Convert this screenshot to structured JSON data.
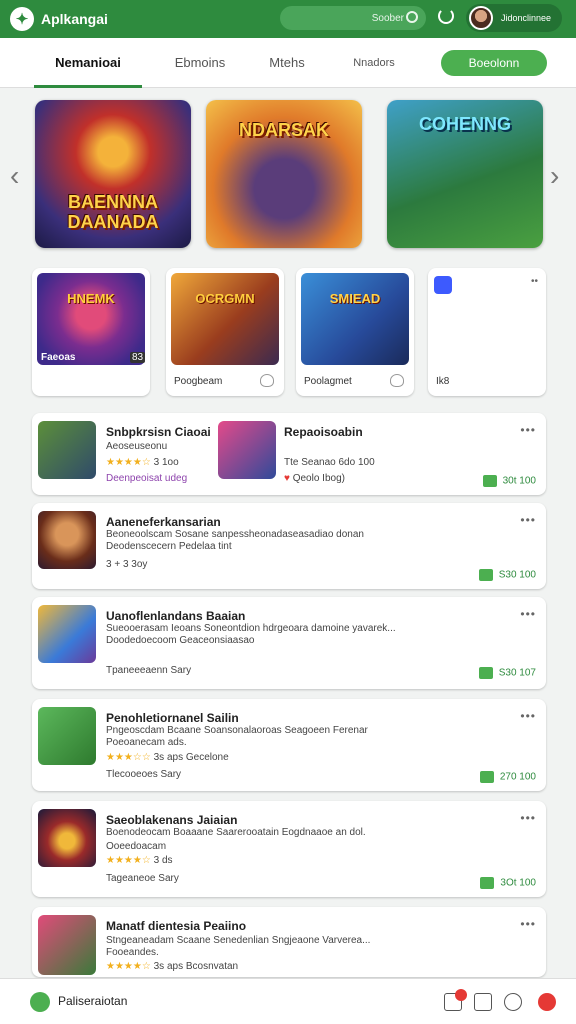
{
  "app": {
    "name": "Aplkangai"
  },
  "header": {
    "search_text": "Soober",
    "user_name": "Jidonclinnee"
  },
  "tabs": [
    {
      "label": "Nemanioai",
      "active": true
    },
    {
      "label": "Ebmoins",
      "active": false
    },
    {
      "label": "Mtehs",
      "active": false
    },
    {
      "label": "Nnadors",
      "active": false
    }
  ],
  "tab_button": "Boeolonn",
  "featured": [
    {
      "title": "BAENNNA DAANADA"
    },
    {
      "title": "NDARSAK"
    },
    {
      "title": "COHENNG"
    }
  ],
  "games_row": [
    {
      "label": "Faeoas",
      "badge": "83",
      "art_text": "HNEMK"
    },
    {
      "label": "Poogbeam",
      "art_text": "OCRGMN"
    },
    {
      "label": "Poolagmet",
      "art_text": "SMIEAD"
    },
    {
      "label": "Ik8"
    }
  ],
  "list": [
    {
      "title": "Snbpkrsisn Ciaoai",
      "line1": "Aeoseuseonu",
      "line2": "3 1oo",
      "line3": "Deenpeoisat udeg",
      "title2": "Repaoisoabin",
      "line4": "Tte Seanao 6do 100",
      "line5": "Qeolo   Ibog)",
      "download": "30t 100"
    },
    {
      "title": "Aaneneferkansarian",
      "line1": "Beoneoolscam  Sosane sanpessheonadaseasadiao donan",
      "line2": "Deodenscecern  Pedelaa tint",
      "line3": "3 + 3 3oy",
      "download": "S30 100"
    },
    {
      "title": "Uanoflenlandans Baaian",
      "line1": "Sueooerasam  Ieoans  Soneontdion hdrgeoara damoine yavarek...",
      "line2": "Doodedoecoom  Geaceonsiaasao",
      "line3": "Tpaneeeaenn Sary",
      "download": "S30 107"
    },
    {
      "title": "Penohletiornanel Sailin",
      "line1": "Pngeoscdam  Bcaane  Soansonalaoroas  Seagoeen Ferenar",
      "line2": "Poeoanecam ads.",
      "line3": "3s aps  Gecelone",
      "line4": "Tlecooeoes Sary",
      "download": "270 100"
    },
    {
      "title": "Saeoblakenans Jaiaian",
      "line1": "Boenodeocam  Boaaane  Saarerooatain  Eogdnaaoe an dol.",
      "line2": "Ooeedoacam",
      "line3": "3 ds",
      "line4": "Tageaneoe Sary",
      "download": "3Ot 100"
    },
    {
      "title": "Manatf dientesia Peaiino",
      "line1": "Stngeaneadam  Scaane  Senedenlian  Sngjeaone Varverea...",
      "line2": "Fooeandes.",
      "line3": "3s aps  Bcosnvatan",
      "download": ""
    }
  ],
  "bottom": {
    "label": "Paliseraiotan"
  }
}
